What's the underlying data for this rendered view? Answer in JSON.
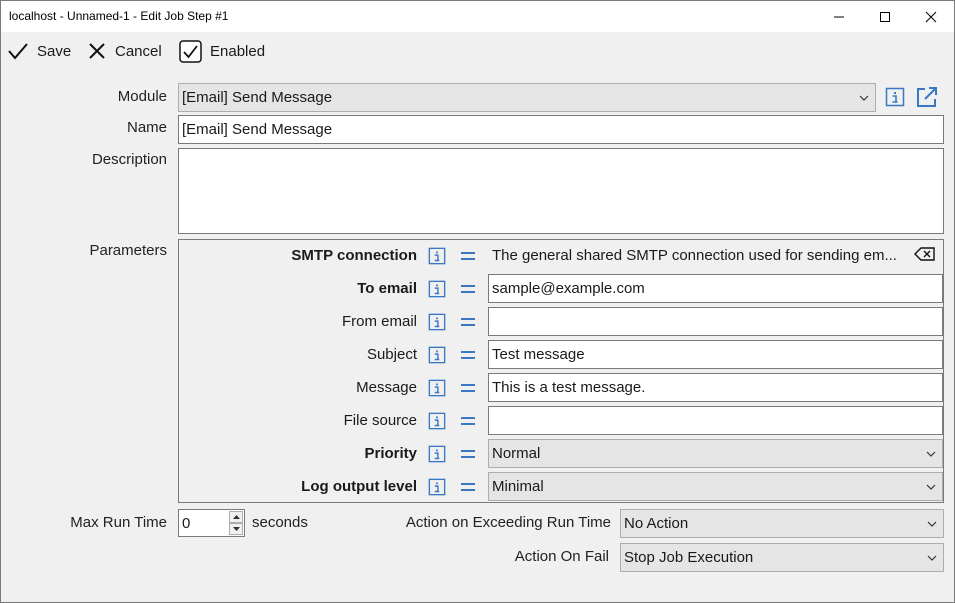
{
  "window": {
    "title": "localhost - Unnamed-1 - Edit Job Step #1"
  },
  "toolbar": {
    "save_label": "Save",
    "cancel_label": "Cancel",
    "enabled_label": "Enabled",
    "enabled_checked": true
  },
  "form": {
    "module_label": "Module",
    "module_value": "[Email] Send Message",
    "name_label": "Name",
    "name_value": "[Email] Send Message",
    "description_label": "Description",
    "description_value": "",
    "parameters_label": "Parameters"
  },
  "parameters": [
    {
      "label": "SMTP connection",
      "bold": true,
      "kind": "text-clear",
      "value": "The general shared SMTP connection used for sending em..."
    },
    {
      "label": "To email",
      "bold": true,
      "kind": "input",
      "value": "sample@example.com"
    },
    {
      "label": "From email",
      "bold": false,
      "kind": "input",
      "value": ""
    },
    {
      "label": "Subject",
      "bold": false,
      "kind": "input",
      "value": "Test message"
    },
    {
      "label": "Message",
      "bold": false,
      "kind": "input",
      "value": "This is a test message."
    },
    {
      "label": "File source",
      "bold": false,
      "kind": "input",
      "value": ""
    },
    {
      "label": "Priority",
      "bold": true,
      "kind": "select",
      "value": "Normal"
    },
    {
      "label": "Log output level",
      "bold": true,
      "kind": "select",
      "value": "Minimal"
    }
  ],
  "runtime": {
    "max_run_time_label": "Max Run Time",
    "max_run_time_value": "0",
    "seconds_label": "seconds",
    "exceed_label": "Action on Exceeding Run Time",
    "exceed_value": "No Action",
    "fail_label": "Action On Fail",
    "fail_value": "Stop Job Execution"
  },
  "colors": {
    "accent": "#3a78c3",
    "window_bg": "#f0f0f0",
    "combo_bg": "#e5e5e5"
  }
}
